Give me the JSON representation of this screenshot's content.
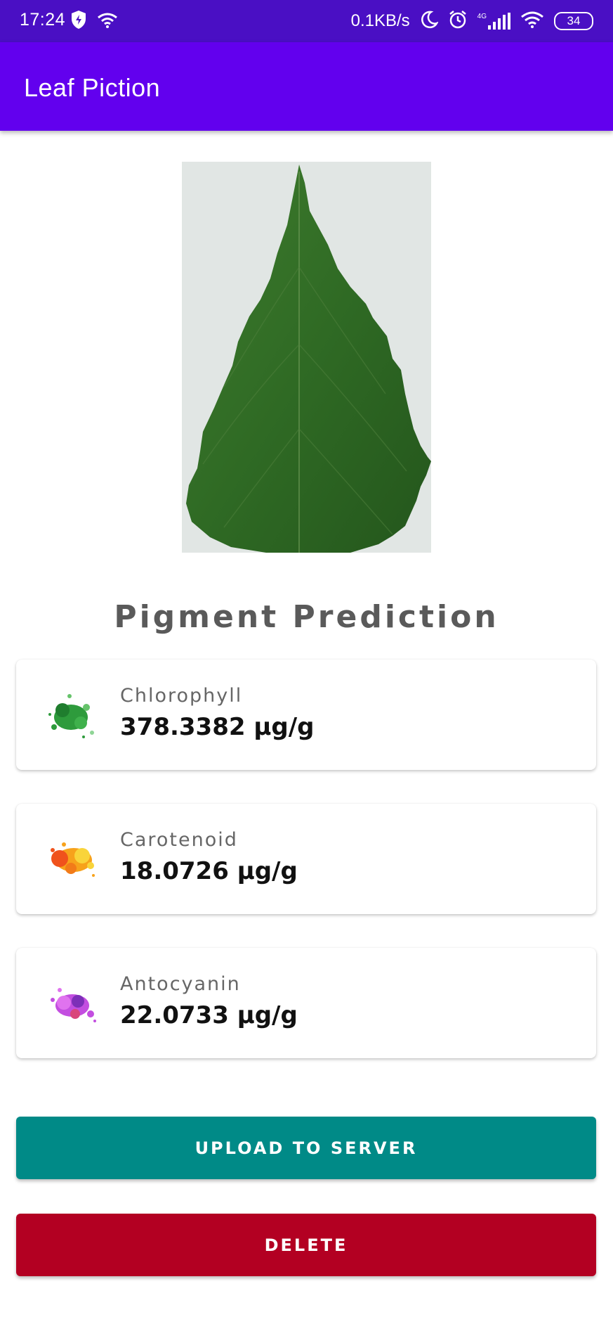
{
  "status_bar": {
    "time": "17:24",
    "speed": "0.1KB/s",
    "network_label": "4G",
    "battery": "34",
    "icons": [
      "shield-icon",
      "wifi-icon",
      "moon-icon",
      "alarm-icon",
      "signal-icon",
      "wifi-icon",
      "battery-icon"
    ]
  },
  "app_bar": {
    "title": "Leaf Piction"
  },
  "section_title": "Pigment Prediction",
  "pigments": [
    {
      "name": "Chlorophyll",
      "value": "378.3382 µg/g",
      "color": "#2e9b3c",
      "icon": "green-splash-icon"
    },
    {
      "name": "Carotenoid",
      "value": "18.0726 µg/g",
      "color": "#f7a21b",
      "icon": "orange-splash-icon"
    },
    {
      "name": "Antocyanin",
      "value": "22.0733 µg/g",
      "color": "#c34ee0",
      "icon": "purple-splash-icon"
    }
  ],
  "buttons": {
    "upload_label": "UPLOAD TO SERVER",
    "delete_label": "DELETE"
  },
  "colors": {
    "status_bar": "#4a0fc4",
    "app_bar": "#6200ee",
    "upload_button": "#008a87",
    "delete_button": "#b30022"
  }
}
